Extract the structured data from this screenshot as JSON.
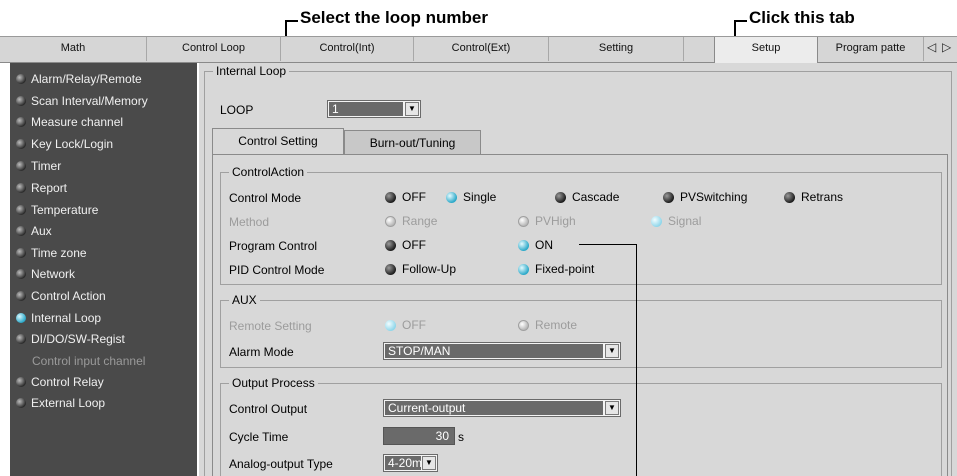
{
  "callouts": {
    "loop": "Select the loop number",
    "tab": "Click this tab"
  },
  "tabs": [
    {
      "label": "Math"
    },
    {
      "label": "Control Loop"
    },
    {
      "label": "Control(Int)"
    },
    {
      "label": "Control(Ext)"
    },
    {
      "label": "Setting"
    },
    {
      "label": "Setup"
    },
    {
      "label": "Program patte"
    }
  ],
  "tab_arrows": {
    "left": "◁",
    "right": "▷"
  },
  "sidebar": {
    "items": [
      {
        "label": "Alarm/Relay/Remote"
      },
      {
        "label": "Scan Interval/Memory"
      },
      {
        "label": "Measure channel"
      },
      {
        "label": "Key Lock/Login"
      },
      {
        "label": "Timer"
      },
      {
        "label": "Report"
      },
      {
        "label": "Temperature"
      },
      {
        "label": "Aux"
      },
      {
        "label": "Time zone"
      },
      {
        "label": "Network"
      },
      {
        "label": "Control Action"
      },
      {
        "label": "Internal Loop"
      },
      {
        "label": "DI/DO/SW-Regist"
      },
      {
        "label": "Control input channel"
      },
      {
        "label": "Control Relay"
      },
      {
        "label": "External Loop"
      }
    ]
  },
  "internal_loop": {
    "title": "Internal Loop",
    "loop_label": "LOOP",
    "loop_value": "1"
  },
  "subtabs": {
    "control_setting": "Control Setting",
    "burnout_tuning": "Burn-out/Tuning"
  },
  "control_action": {
    "title": "ControlAction",
    "control_mode_label": "Control Mode",
    "control_mode_options": [
      "OFF",
      "Single",
      "Cascade",
      "PVSwitching",
      "Retrans"
    ],
    "method_label": "Method",
    "method_options": [
      "Range",
      "PVHigh",
      "Signal"
    ],
    "program_control_label": "Program Control",
    "program_control_options": [
      "OFF",
      "ON"
    ],
    "pid_label": "PID Control Mode",
    "pid_options": [
      "Follow-Up",
      "Fixed-point"
    ]
  },
  "aux": {
    "title": "AUX",
    "remote_label": "Remote Setting",
    "remote_options": [
      "OFF",
      "Remote"
    ],
    "alarm_label": "Alarm Mode",
    "alarm_value": "STOP/MAN"
  },
  "output": {
    "title": "Output Process",
    "control_output_label": "Control Output",
    "control_output_value": "Current-output",
    "cycle_label": "Cycle Time",
    "cycle_value": "30",
    "cycle_unit": "s",
    "analog_label": "Analog-output Type",
    "analog_value": "4-20mA"
  },
  "icons": {
    "combo_arrow": "▼"
  }
}
